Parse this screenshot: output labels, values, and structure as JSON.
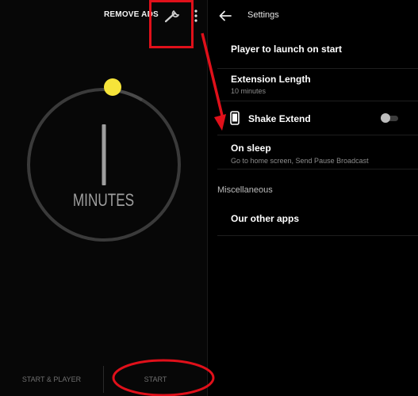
{
  "timer": {
    "remove_ads_label": "REMOVE ADS",
    "dial_number": "1",
    "dial_unit": "MINUTES",
    "start_player_label": "START & PLAYER",
    "start_label": "START"
  },
  "settings": {
    "title": "Settings",
    "items": [
      {
        "title": "Player to launch on start",
        "subtitle": ""
      },
      {
        "title": "Extension Length",
        "subtitle": "10 minutes"
      },
      {
        "title": "Shake Extend",
        "subtitle": "",
        "toggle_on": false
      },
      {
        "title": "On sleep",
        "subtitle": "Go to home screen, Send Pause Broadcast"
      }
    ],
    "section_header": "Miscellaneous",
    "misc_items": [
      {
        "title": "Our other apps"
      }
    ]
  },
  "icons": {
    "wrench": "wrench-icon",
    "more": "more-vert-icon",
    "back": "arrow-back-icon",
    "phone": "phone-shake-icon"
  },
  "colors": {
    "accent_knob": "#f6e43a",
    "annotation": "#e0101a",
    "background": "#000000"
  }
}
